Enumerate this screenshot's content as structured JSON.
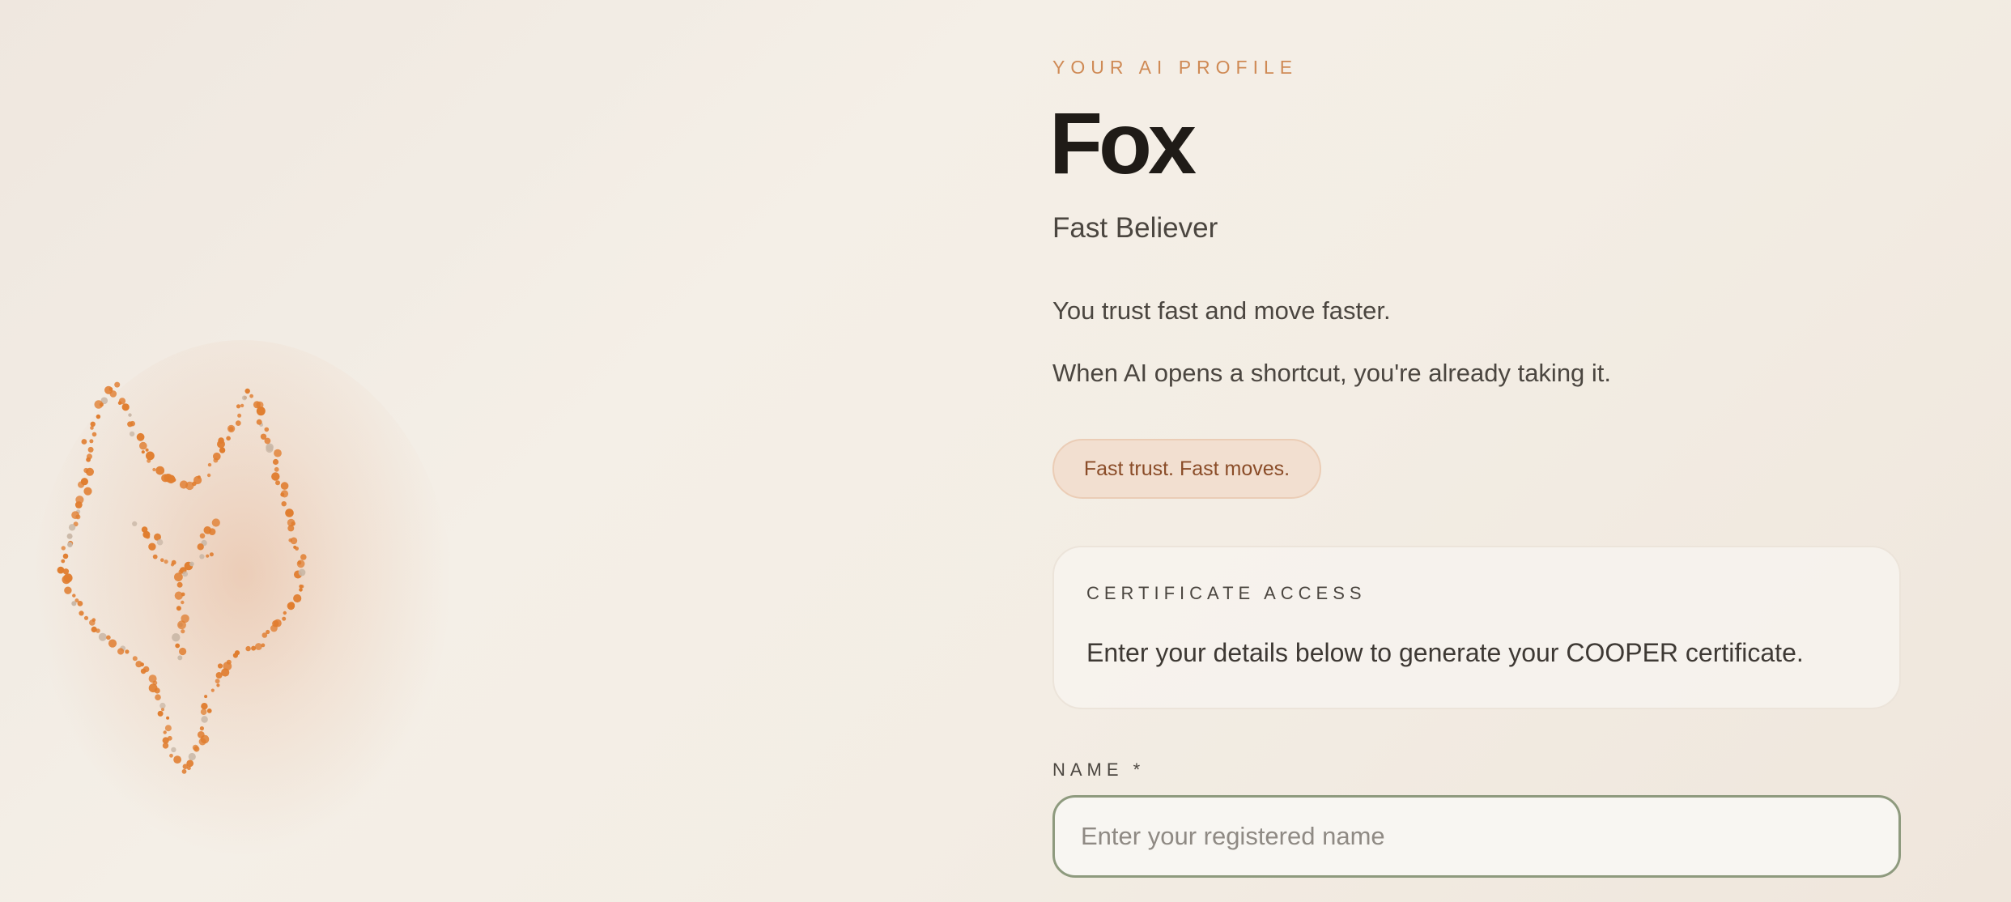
{
  "profile": {
    "eyebrow": "YOUR AI PROFILE",
    "animal": "Fox",
    "type": "Fast Believer",
    "description_lines": [
      "You trust fast and move faster.",
      "When AI opens a shortcut, you're already taking it."
    ],
    "tagline": "Fast trust. Fast moves.",
    "illustration": "fox-dot-outline-icon",
    "accent_color": "#cf8a55",
    "dot_color": "#e07d2f"
  },
  "certificate": {
    "label": "CERTIFICATE ACCESS",
    "text": "Enter your details below to generate your COOPER certificate."
  },
  "form": {
    "name_label": "NAME *",
    "name_placeholder": "Enter your registered name",
    "name_value": ""
  }
}
